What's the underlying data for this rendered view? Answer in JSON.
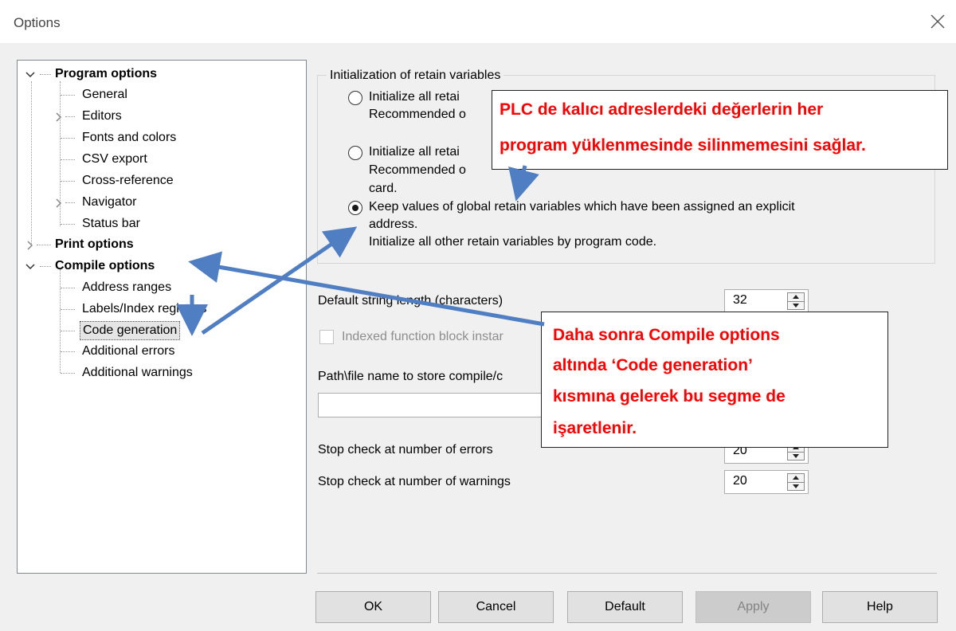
{
  "window": {
    "title": "Options"
  },
  "tree": {
    "program_options": "Program options",
    "general": "General",
    "editors": "Editors",
    "fonts_and_colors": "Fonts and colors",
    "csv_export": "CSV export",
    "cross_reference": "Cross-reference",
    "navigator": "Navigator",
    "status_bar": "Status bar",
    "print_options": "Print options",
    "compile_options": "Compile options",
    "address_ranges": "Address ranges",
    "labels_index_registers": "Labels/Index registers",
    "code_generation": "Code generation",
    "additional_errors": "Additional errors",
    "additional_warnings": "Additional warnings"
  },
  "retain": {
    "group_title": "Initialization of retain variables",
    "option1_line1": "Initialize all retai",
    "option1_line2": "Recommended o",
    "option2_line1": "Initialize all retai",
    "option2_line2": "Recommended o",
    "option2_line3": "card.",
    "option3_line1": "Keep values of global retain variables which have been assigned an explicit",
    "option3_line2": "address.",
    "option3_line3": "Initialize all other retain variables by program code."
  },
  "form": {
    "default_string_length_label": "Default string length (characters)",
    "default_string_length_value": "32",
    "indexed_fb_label": "Indexed function block instar",
    "path_label": "Path\\file name to store compile/c",
    "stop_errors_label": "Stop check at number of errors",
    "stop_errors_value": "20",
    "stop_warnings_label": "Stop check at number of warnings",
    "stop_warnings_value": "20"
  },
  "buttons": {
    "ok": "OK",
    "cancel": "Cancel",
    "default": "Default",
    "apply": "Apply",
    "help": "Help"
  },
  "annotations": {
    "callout1_line1": "PLC de kalıcı adreslerdeki değerlerin  her",
    "callout1_line2": "program yüklenmesinde silinmemesini sağlar.",
    "callout2_line1": "Daha sonra Compile options",
    "callout2_line2": "altında ‘Code generation’",
    "callout2_line3": "kısmına gelerek bu segme de",
    "callout2_line4": "işaretlenir."
  },
  "colors": {
    "annotation_text": "#ff0000",
    "arrow": "#4f7ec3",
    "disabled_button": "#cccccc"
  }
}
